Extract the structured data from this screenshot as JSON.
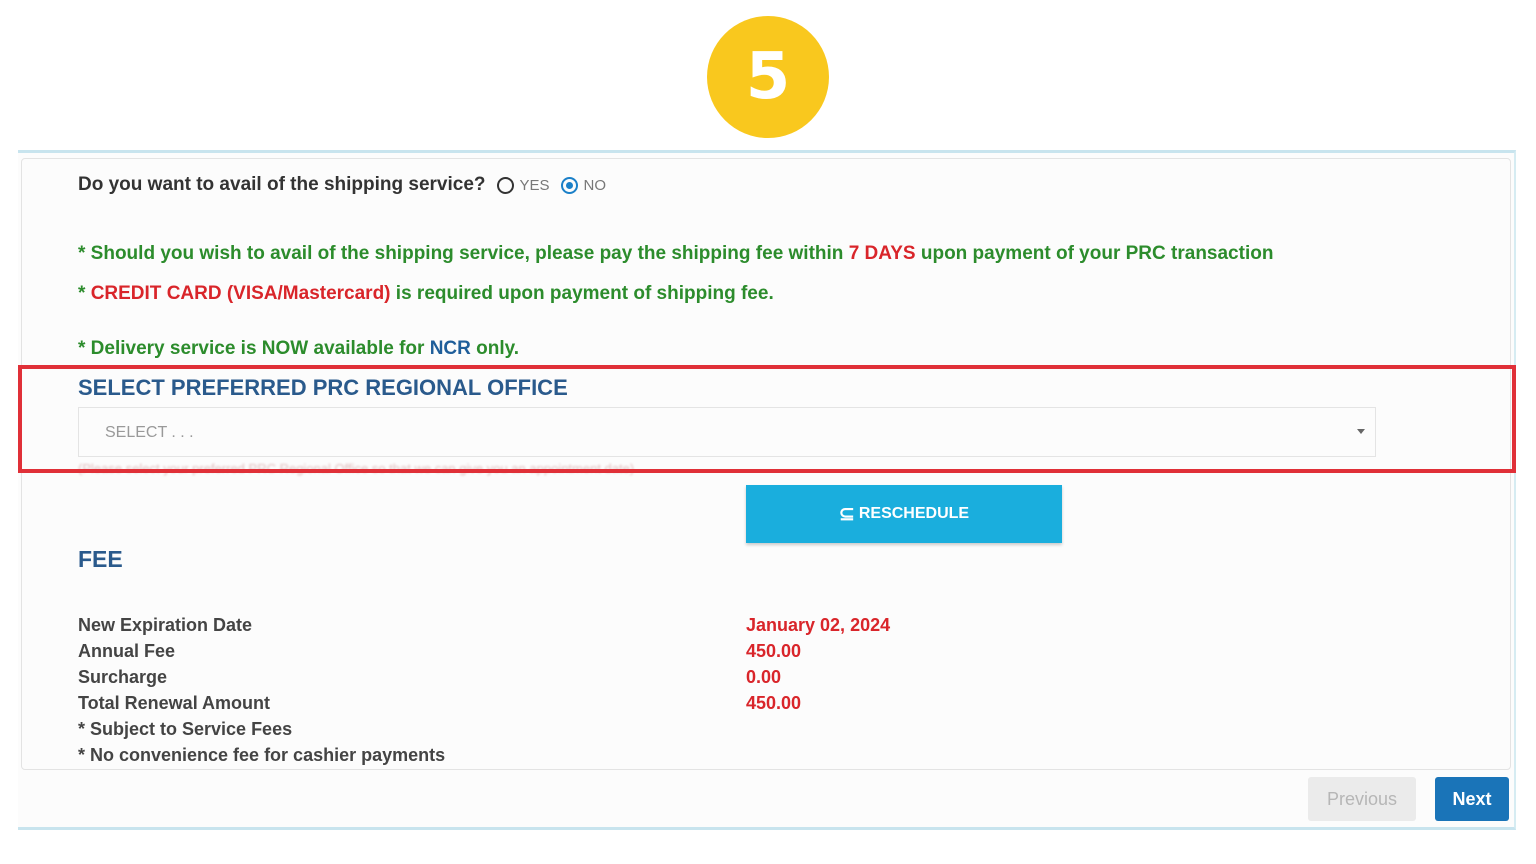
{
  "step_badge": "5",
  "shipping": {
    "question": "Do you want to avail of the shipping service?",
    "yes_label": "YES",
    "no_label": "NO",
    "selected": "NO"
  },
  "notes": {
    "note1_a": "* Should you wish to avail of the shipping service, please pay the shipping fee within ",
    "note1_b": "7 DAYS",
    "note1_c": " upon payment of your PRC transaction",
    "note2_a": "* ",
    "note2_b": "CREDIT CARD (VISA/Mastercard)",
    "note2_c": " is required upon payment of shipping fee.",
    "note3_a": "* Delivery service is NOW available for ",
    "note3_b": "NCR",
    "note3_c": " only."
  },
  "regional_office": {
    "title": "SELECT PREFERRED PRC REGIONAL OFFICE",
    "placeholder": "SELECT . . .",
    "hint": "(Please select your preferred PRC Regional Office so that we can give you an appointment date)"
  },
  "reschedule_label": "RESCHEDULE",
  "fee": {
    "title": "FEE",
    "rows": [
      {
        "label": "New Expiration Date",
        "value": "January 02, 2024"
      },
      {
        "label": "Annual Fee",
        "value": "450.00"
      },
      {
        "label": "Surcharge",
        "value": "0.00"
      },
      {
        "label": "Total Renewal Amount",
        "value": "450.00"
      }
    ],
    "footnote1": "* Subject to Service Fees",
    "footnote2": "* No convenience fee for cashier payments"
  },
  "nav": {
    "previous": "Previous",
    "next": "Next"
  },
  "colors": {
    "badge": "#f9c81e",
    "accent_blue": "#1aaedd",
    "next_blue": "#1a74b8",
    "highlight_red": "#e03038",
    "note_green": "#2c8c2c",
    "value_red": "#d9252a"
  }
}
